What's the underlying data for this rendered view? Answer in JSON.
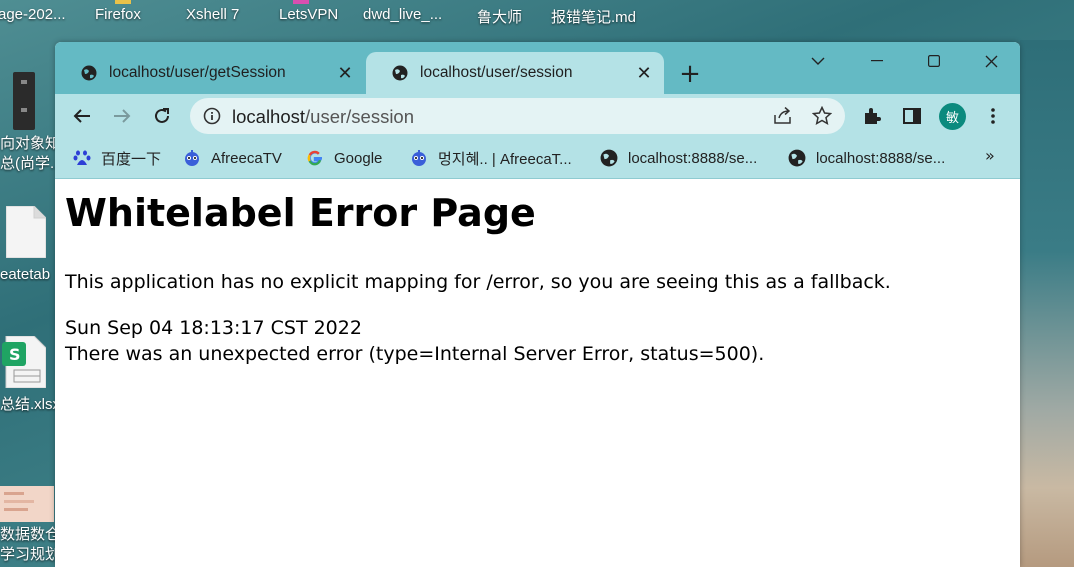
{
  "desktop": {
    "top_items": [
      "age-202...",
      "Firefox",
      "Xshell 7",
      "LetsVPN",
      "dwd_live_...",
      "鲁大师",
      "报错笔记.md"
    ],
    "left_items": [
      {
        "label": "向对象知\n总(尚学..."
      },
      {
        "label": "eatetab"
      },
      {
        "label": "总结.xlsx"
      },
      {
        "label": "数据数仓\n学习规划"
      }
    ]
  },
  "browser": {
    "tabs": [
      {
        "title": "localhost/user/getSession",
        "active": false
      },
      {
        "title": "localhost/user/session",
        "active": true
      }
    ],
    "address": {
      "host": "localhost",
      "path": "/user/session"
    },
    "profile_initial": "敏",
    "bookmarks": [
      {
        "label": "百度一下",
        "icon": "baidu-icon"
      },
      {
        "label": "AfreecaTV",
        "icon": "afreecatv-icon"
      },
      {
        "label": "Google",
        "icon": "google-icon"
      },
      {
        "label": "멍지혜.. | AfreecaT...",
        "icon": "afreecatv-icon"
      },
      {
        "label": "localhost:8888/se...",
        "icon": "globe-icon"
      },
      {
        "label": "localhost:8888/se...",
        "icon": "globe-icon"
      }
    ],
    "bookmarks_more": "»"
  },
  "page": {
    "title": "Whitelabel Error Page",
    "message": "This application has no explicit mapping for /error, so you are seeing this as a fallback.",
    "timestamp": "Sun Sep 04 18:13:17 CST 2022",
    "error": "There was an unexpected error (type=Internal Server Error, status=500)."
  },
  "colors": {
    "titlebar": "#64bac4",
    "toolbar": "#b4e2e6",
    "avatar": "#0b8a7e"
  }
}
